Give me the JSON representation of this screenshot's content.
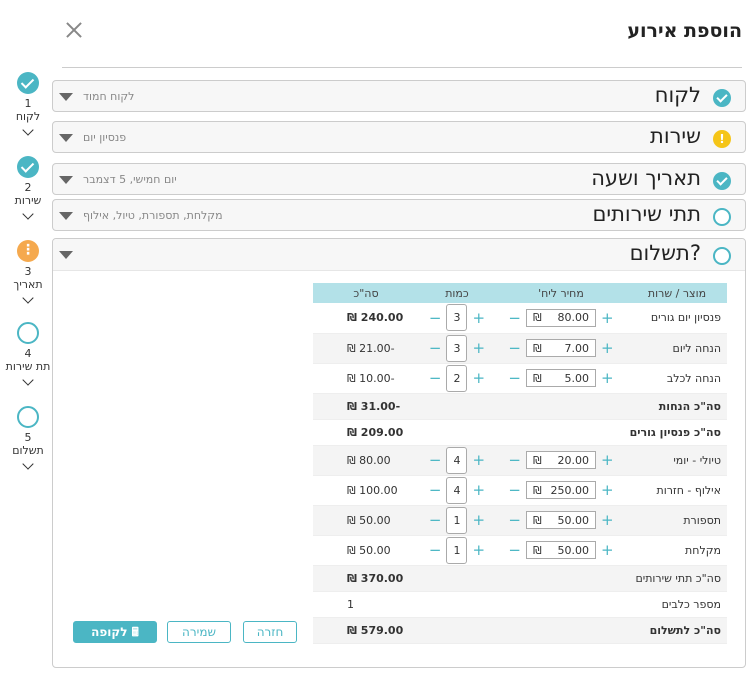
{
  "header": {
    "title": "הוספת אירוע"
  },
  "stepper": [
    {
      "num": "1",
      "label": "לקוח",
      "state": "done"
    },
    {
      "num": "2",
      "label": "שירות",
      "state": "done"
    },
    {
      "num": "3",
      "label": "תאריך",
      "state": "warning"
    },
    {
      "num": "4",
      "label": "תת שירות",
      "state": "open"
    },
    {
      "num": "5",
      "label": "תשלום",
      "state": "open"
    }
  ],
  "sections": [
    {
      "title": "לקוח",
      "subtitle": "לקוח חמוד",
      "state": "done"
    },
    {
      "title": "שירות",
      "subtitle": "פנסיון יום",
      "state": "warning"
    },
    {
      "title": "תאריך ושעה",
      "subtitle": "יום חמישי, 5 דצמבר",
      "state": "done"
    },
    {
      "title": "תתי שירותים",
      "subtitle": "מקלחת, תספורת, טיול, אילוף",
      "state": "open"
    },
    {
      "title": "תשלום?",
      "subtitle": "",
      "state": "open"
    }
  ],
  "table": {
    "headers": {
      "product": "מוצר / שרות",
      "price": "מחיר ליח'",
      "qty": "כמות",
      "total": "סה\"כ"
    },
    "currency": "₪",
    "rows": [
      {
        "product": "פנסיון יום גורים",
        "price": "80.00",
        "qty": "3",
        "total": "240.00"
      },
      {
        "product": "הנחה ליום",
        "price": "7.00",
        "qty": "3",
        "total": "-21.00"
      },
      {
        "product": "הנחה לכלב",
        "price": "5.00",
        "qty": "2",
        "total": "-10.00"
      },
      {
        "product": "סה\"כ הנחות",
        "total": "-31.00"
      },
      {
        "product": "סה\"כ פנסיון גורים",
        "total": "209.00"
      },
      {
        "product": "טיולי - יומי",
        "price": "20.00",
        "qty": "4",
        "total": "80.00"
      },
      {
        "product": "אילוף - חזרות",
        "price": "250.00",
        "qty": "4",
        "total": "100.00"
      },
      {
        "product": "תספורת",
        "price": "50.00",
        "qty": "1",
        "total": "50.00"
      },
      {
        "product": "מקלחת",
        "price": "50.00",
        "qty": "1",
        "total": "50.00"
      },
      {
        "product": "סה\"כ תתי שירותים",
        "total": "370.00"
      },
      {
        "product": "מספר כלבים",
        "total": "1"
      },
      {
        "product": "סה\"כ לתשלום",
        "total": "579.00"
      }
    ]
  },
  "buttons": {
    "checkout": "לקופה",
    "save": "שמירה",
    "back": "חזרה"
  }
}
